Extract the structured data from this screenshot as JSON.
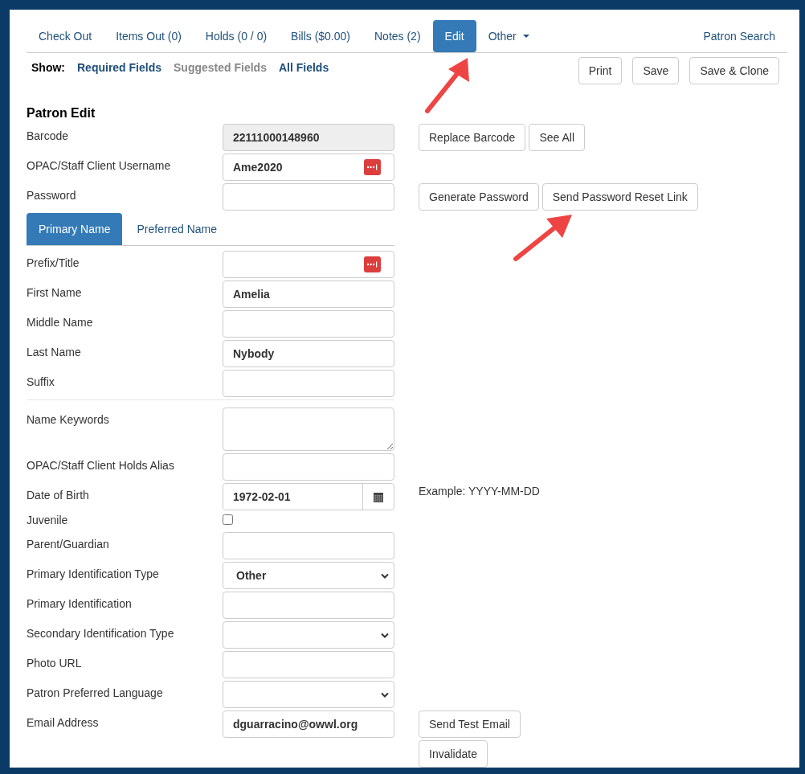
{
  "nav_tabs": [
    {
      "label": "Check Out",
      "selected": false,
      "dropdown": false
    },
    {
      "label": "Items Out (0)",
      "selected": false,
      "dropdown": false
    },
    {
      "label": "Holds (0 / 0)",
      "selected": false,
      "dropdown": false
    },
    {
      "label": "Bills ($0.00)",
      "selected": false,
      "dropdown": false
    },
    {
      "label": "Notes (2)",
      "selected": false,
      "dropdown": false
    },
    {
      "label": "Edit",
      "selected": true,
      "dropdown": false
    },
    {
      "label": "Other",
      "selected": false,
      "dropdown": true
    }
  ],
  "patron_search": "Patron Search",
  "show": {
    "label": "Show:",
    "options": [
      {
        "label": "Required Fields",
        "enabled": true
      },
      {
        "label": "Suggested Fields",
        "enabled": false
      },
      {
        "label": "All Fields",
        "enabled": true
      }
    ]
  },
  "actions": [
    "Print",
    "Save",
    "Save & Clone"
  ],
  "heading": "Patron Edit",
  "rows": [
    {
      "kind": "readonly",
      "label": "Barcode",
      "value": "22111000148960",
      "buttons": [
        "Replace Barcode",
        "See All"
      ]
    },
    {
      "kind": "text",
      "label": "OPAC/Staff Client Username",
      "value": "Ame2020",
      "password_manager_icon": true
    },
    {
      "kind": "text",
      "label": "Password",
      "buttons": [
        "Generate Password",
        "Send Password Reset Link"
      ]
    },
    {
      "kind": "tabs",
      "tabs": [
        {
          "label": "Primary Name",
          "selected": true
        },
        {
          "label": "Preferred Name",
          "selected": false
        }
      ]
    },
    {
      "kind": "text",
      "label": "Prefix/Title",
      "password_manager_icon": true
    },
    {
      "kind": "text",
      "label": "First Name",
      "value": "Amelia"
    },
    {
      "kind": "text",
      "label": "Middle Name"
    },
    {
      "kind": "text",
      "label": "Last Name",
      "value": "Nybody"
    },
    {
      "kind": "text",
      "label": "Suffix"
    },
    {
      "kind": "divider"
    },
    {
      "kind": "textarea",
      "label": "Name Keywords"
    },
    {
      "kind": "text",
      "label": "OPAC/Staff Client Holds Alias"
    },
    {
      "kind": "date",
      "label": "Date of Birth",
      "value": "1972-02-01",
      "note": "Example: YYYY-MM-DD"
    },
    {
      "kind": "checkbox",
      "label": "Juvenile",
      "checked": false
    },
    {
      "kind": "text",
      "label": "Parent/Guardian"
    },
    {
      "kind": "select",
      "label": "Primary Identification Type",
      "value": "Other"
    },
    {
      "kind": "text",
      "label": "Primary Identification"
    },
    {
      "kind": "select",
      "label": "Secondary Identification Type"
    },
    {
      "kind": "text",
      "label": "Photo URL"
    },
    {
      "kind": "select",
      "label": "Patron Preferred Language"
    },
    {
      "kind": "text",
      "label": "Email Address",
      "value": "dguarracino@owwl.org",
      "buttons": [
        "Send Test Email"
      ],
      "buttons_below": [
        "Invalidate"
      ]
    }
  ]
}
